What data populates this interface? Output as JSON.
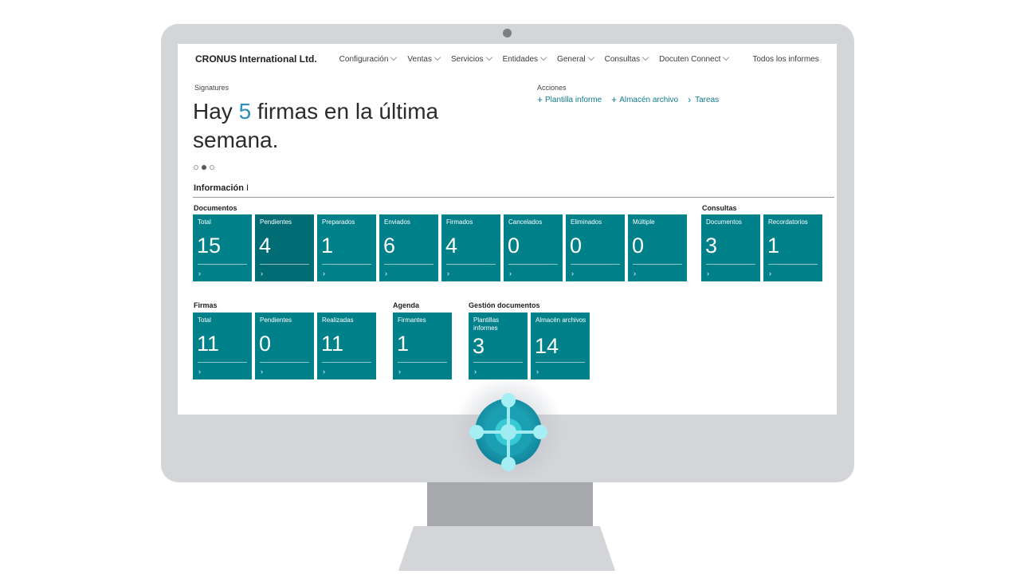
{
  "nav": {
    "brand": "CRONUS International Ltd.",
    "menu": [
      "Configuración",
      "Ventas",
      "Servicios",
      "Entidades",
      "General",
      "Consultas",
      "Docuten Connect"
    ],
    "all_reports": "Todos los informes",
    "more": "⋮"
  },
  "hero": {
    "caption": "Signatures",
    "text_before": "Hay ",
    "number": "5",
    "text_after": " firmas en la última semana."
  },
  "actions": {
    "caption": "Acciones",
    "items": [
      "Plantilla informe",
      "Almacén archivo",
      "Tareas"
    ]
  },
  "section": {
    "title": "Información",
    "cursor": "I"
  },
  "groups": {
    "documentos": {
      "title": "Documentos",
      "tiles": [
        {
          "label": "Total",
          "value": "15"
        },
        {
          "label": "Pendientes",
          "value": "4"
        },
        {
          "label": "Preparados",
          "value": "1"
        },
        {
          "label": "Enviados",
          "value": "6"
        },
        {
          "label": "Firmados",
          "value": "4"
        },
        {
          "label": "Cancelados",
          "value": "0"
        },
        {
          "label": "Eliminados",
          "value": "0"
        },
        {
          "label": "Múltiple",
          "value": "0"
        }
      ]
    },
    "consultas": {
      "title": "Consultas",
      "tiles": [
        {
          "label": "Documentos",
          "value": "3"
        },
        {
          "label": "Recordatorios",
          "value": "1"
        }
      ]
    },
    "firmas": {
      "title": "Firmas",
      "tiles": [
        {
          "label": "Total",
          "value": "11"
        },
        {
          "label": "Pendientes",
          "value": "0"
        },
        {
          "label": "Realizadas",
          "value": "11"
        }
      ]
    },
    "agenda": {
      "title": "Agenda",
      "tiles": [
        {
          "label": "Firmantes",
          "value": "1"
        }
      ]
    },
    "gestion": {
      "title": "Gestión documentos",
      "tiles": [
        {
          "label": "Plantillas informes",
          "value": "3"
        },
        {
          "label": "Almacén archivos",
          "value": "14"
        }
      ]
    }
  },
  "tile_chevron": "›",
  "colors": {
    "tile": "#00818a",
    "tile_active": "#006c74",
    "accent_number": "#2a8fbd",
    "action_link": "#117a8b",
    "monitor_frame": "#d4d5d8"
  }
}
